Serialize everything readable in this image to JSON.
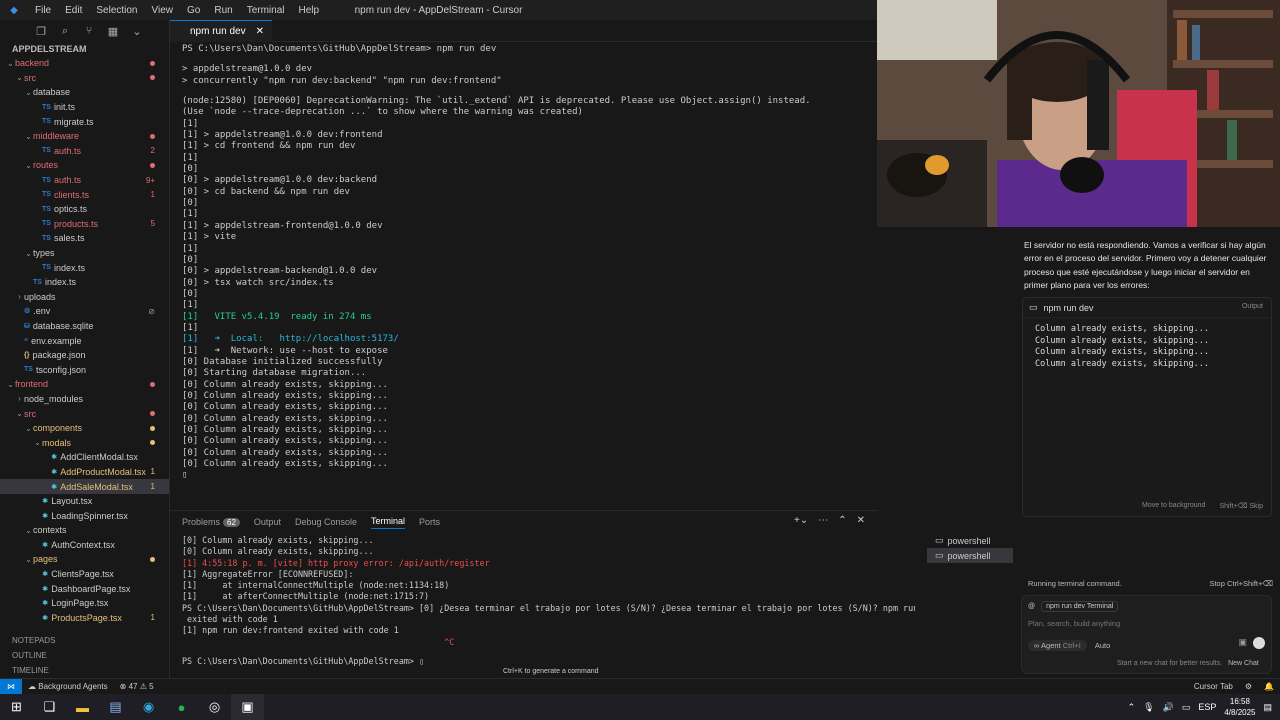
{
  "window": {
    "title": "npm run dev - AppDelStream - Cursor",
    "menu": [
      "File",
      "Edit",
      "Selection",
      "View",
      "Go",
      "Run",
      "Terminal",
      "Help"
    ]
  },
  "explorer": {
    "root": "APPDELSTREAM",
    "items": [
      {
        "label": "backend",
        "depth": 0,
        "kind": "folder-open",
        "color": "#e06c75",
        "dot": true
      },
      {
        "label": "src",
        "depth": 1,
        "kind": "folder-open",
        "color": "#e06c75",
        "dot": true
      },
      {
        "label": "database",
        "depth": 2,
        "kind": "folder-open",
        "color": "#cccccc"
      },
      {
        "label": "init.ts",
        "depth": 3,
        "kind": "ts",
        "color": "#cccccc"
      },
      {
        "label": "migrate.ts",
        "depth": 3,
        "kind": "ts",
        "color": "#cccccc"
      },
      {
        "label": "middleware",
        "depth": 2,
        "kind": "folder-open",
        "color": "#e06c75",
        "dot": true
      },
      {
        "label": "auth.ts",
        "depth": 3,
        "kind": "ts",
        "color": "#e06c75",
        "badge": "2"
      },
      {
        "label": "routes",
        "depth": 2,
        "kind": "folder-open",
        "color": "#e06c75",
        "dot": true
      },
      {
        "label": "auth.ts",
        "depth": 3,
        "kind": "ts",
        "color": "#e06c75",
        "badge": "9+"
      },
      {
        "label": "clients.ts",
        "depth": 3,
        "kind": "ts",
        "color": "#e06c75",
        "badge": "1"
      },
      {
        "label": "optics.ts",
        "depth": 3,
        "kind": "ts",
        "color": "#cccccc"
      },
      {
        "label": "products.ts",
        "depth": 3,
        "kind": "ts",
        "color": "#e06c75",
        "badge": "5"
      },
      {
        "label": "sales.ts",
        "depth": 3,
        "kind": "ts",
        "color": "#cccccc"
      },
      {
        "label": "types",
        "depth": 2,
        "kind": "folder-open",
        "color": "#cccccc"
      },
      {
        "label": "index.ts",
        "depth": 3,
        "kind": "ts",
        "color": "#cccccc"
      },
      {
        "label": "index.ts",
        "depth": 2,
        "kind": "ts",
        "color": "#cccccc"
      },
      {
        "label": "uploads",
        "depth": 1,
        "kind": "folder",
        "color": "#cccccc"
      },
      {
        "label": ".env",
        "depth": 1,
        "kind": "gear",
        "color": "#cccccc",
        "badge": "⊘"
      },
      {
        "label": "database.sqlite",
        "depth": 1,
        "kind": "db",
        "color": "#cccccc"
      },
      {
        "label": "env.example",
        "depth": 1,
        "kind": "file",
        "color": "#cccccc"
      },
      {
        "label": "package.json",
        "depth": 1,
        "kind": "json",
        "color": "#cccccc"
      },
      {
        "label": "tsconfig.json",
        "depth": 1,
        "kind": "tsjson",
        "color": "#cccccc"
      },
      {
        "label": "frontend",
        "depth": 0,
        "kind": "folder-open",
        "color": "#e06c75",
        "dot": true
      },
      {
        "label": "node_modules",
        "depth": 1,
        "kind": "folder",
        "color": "#cccccc"
      },
      {
        "label": "src",
        "depth": 1,
        "kind": "folder-open",
        "color": "#e06c75",
        "dot": true
      },
      {
        "label": "components",
        "depth": 2,
        "kind": "folder-open",
        "color": "#e5c07b",
        "dot": true
      },
      {
        "label": "modals",
        "depth": 3,
        "kind": "folder-open",
        "color": "#e5c07b",
        "dot": true
      },
      {
        "label": "AddClientModal.tsx",
        "depth": 4,
        "kind": "tsx",
        "color": "#cccccc"
      },
      {
        "label": "AddProductModal.tsx",
        "depth": 4,
        "kind": "tsx",
        "color": "#e5c07b",
        "badge": "1"
      },
      {
        "label": "AddSaleModal.tsx",
        "depth": 4,
        "kind": "tsx",
        "color": "#e5c07b",
        "badge": "1",
        "selected": true
      },
      {
        "label": "Layout.tsx",
        "depth": 3,
        "kind": "tsx",
        "color": "#cccccc"
      },
      {
        "label": "LoadingSpinner.tsx",
        "depth": 3,
        "kind": "tsx",
        "color": "#cccccc"
      },
      {
        "label": "contexts",
        "depth": 2,
        "kind": "folder-open",
        "color": "#cccccc"
      },
      {
        "label": "AuthContext.tsx",
        "depth": 3,
        "kind": "tsx",
        "color": "#cccccc"
      },
      {
        "label": "pages",
        "depth": 2,
        "kind": "folder-open",
        "color": "#e5c07b",
        "dot": true
      },
      {
        "label": "ClientsPage.tsx",
        "depth": 3,
        "kind": "tsx",
        "color": "#cccccc"
      },
      {
        "label": "DashboardPage.tsx",
        "depth": 3,
        "kind": "tsx",
        "color": "#cccccc"
      },
      {
        "label": "LoginPage.tsx",
        "depth": 3,
        "kind": "tsx",
        "color": "#cccccc"
      },
      {
        "label": "ProductsPage.tsx",
        "depth": 3,
        "kind": "tsx",
        "color": "#e5c07b",
        "badge": "1"
      }
    ],
    "footer": {
      "notepads": "NOTEPADS",
      "outline": "OUTLINE",
      "timeline": "TIMELINE"
    }
  },
  "editor": {
    "tab_label": "npm run dev",
    "lines": [
      {
        "t": "PS C:\\Users\\Dan\\Documents\\GitHub\\AppDelStream> npm run dev",
        "c": "#cccccc"
      },
      {
        "t": "",
        "c": "#cccccc"
      },
      {
        "t": "> appdelstream@1.0.0 dev",
        "c": "#cccccc"
      },
      {
        "t": "> concurrently \"npm run dev:backend\" \"npm run dev:frontend\"",
        "c": "#cccccc"
      },
      {
        "t": "",
        "c": "#cccccc"
      },
      {
        "t": "(node:12580) [DEP0060] DeprecationWarning: The `util._extend` API is deprecated. Please use Object.assign() instead.",
        "c": "#cccccc"
      },
      {
        "t": "(Use `node --trace-deprecation ...` to show where the warning was created)",
        "c": "#cccccc"
      },
      {
        "t": "[1]",
        "c": "#cccccc"
      },
      {
        "t": "[1] > appdelstream@1.0.0 dev:frontend",
        "c": "#cccccc"
      },
      {
        "t": "[1] > cd frontend && npm run dev",
        "c": "#cccccc"
      },
      {
        "t": "[1]",
        "c": "#cccccc"
      },
      {
        "t": "[0]",
        "c": "#cccccc"
      },
      {
        "t": "[0] > appdelstream@1.0.0 dev:backend",
        "c": "#cccccc"
      },
      {
        "t": "[0] > cd backend && npm run dev",
        "c": "#cccccc"
      },
      {
        "t": "[0]",
        "c": "#cccccc"
      },
      {
        "t": "[1]",
        "c": "#cccccc"
      },
      {
        "t": "[1] > appdelstream-frontend@1.0.0 dev",
        "c": "#cccccc"
      },
      {
        "t": "[1] > vite",
        "c": "#cccccc"
      },
      {
        "t": "[1]",
        "c": "#cccccc"
      },
      {
        "t": "[0]",
        "c": "#cccccc"
      },
      {
        "t": "[0] > appdelstream-backend@1.0.0 dev",
        "c": "#cccccc"
      },
      {
        "t": "[0] > tsx watch src/index.ts",
        "c": "#cccccc"
      },
      {
        "t": "[0]",
        "c": "#cccccc"
      },
      {
        "t": "[1]",
        "c": "#cccccc"
      },
      {
        "t": "[1]   VITE v5.4.19  ready in 274 ms",
        "c": "#23d18b"
      },
      {
        "t": "[1]",
        "c": "#cccccc"
      },
      {
        "t": "[1]   ➜  Local:   http://localhost:5173/",
        "c": "#29b8db"
      },
      {
        "t": "[1]   ➜  Network: use --host to expose",
        "c": "#cccccc"
      },
      {
        "t": "[0] Database initialized successfully",
        "c": "#cccccc"
      },
      {
        "t": "[0] Starting database migration...",
        "c": "#cccccc"
      },
      {
        "t": "[0] Column already exists, skipping...",
        "c": "#cccccc"
      },
      {
        "t": "[0] Column already exists, skipping...",
        "c": "#cccccc"
      },
      {
        "t": "[0] Column already exists, skipping...",
        "c": "#cccccc"
      },
      {
        "t": "[0] Column already exists, skipping...",
        "c": "#cccccc"
      },
      {
        "t": "[0] Column already exists, skipping...",
        "c": "#cccccc"
      },
      {
        "t": "[0] Column already exists, skipping...",
        "c": "#cccccc"
      },
      {
        "t": "[0] Column already exists, skipping...",
        "c": "#cccccc"
      },
      {
        "t": "[0] Column already exists, skipping...",
        "c": "#cccccc"
      },
      {
        "t": "▯",
        "c": "#cccccc"
      }
    ]
  },
  "panel": {
    "tabs": [
      "Problems",
      "Output",
      "Debug Console",
      "Terminal",
      "Ports"
    ],
    "problems_count": "62",
    "active_tab": "Terminal",
    "terminal_lines": [
      {
        "t": "[0] Column already exists, skipping...",
        "c": "#cccccc"
      },
      {
        "t": "[0] Column already exists, skipping...",
        "c": "#cccccc"
      },
      {
        "t": "[1] 4:55:18 p. m. [vite] http proxy error: /api/auth/register",
        "c": "#f14c4c"
      },
      {
        "t": "[1] AggregateError [ECONNREFUSED]:",
        "c": "#cccccc"
      },
      {
        "t": "[1]     at internalConnectMultiple (node:net:1134:18)",
        "c": "#cccccc"
      },
      {
        "t": "[1]     at afterConnectMultiple (node:net:1715:7)",
        "c": "#cccccc"
      },
      {
        "t": "PS C:\\Users\\Dan\\Documents\\GitHub\\AppDelStream> [0] ¿Desea terminar el trabajo por lotes (S/N)? ¿Desea terminar el trabajo por lotes (S/N)? npm run dev:backend",
        "c": "#cccccc"
      },
      {
        "t": " exited with code 1",
        "c": "#cccccc"
      },
      {
        "t": "[1] npm run dev:frontend exited with code 1",
        "c": "#cccccc"
      },
      {
        "t": "                                                    ^C",
        "c": "#f14c4c"
      },
      {
        "t": "",
        "c": "#cccccc"
      },
      {
        "t": "PS C:\\Users\\Dan\\Documents\\GitHub\\AppDelStream> ▯",
        "c": "#cccccc"
      }
    ],
    "terminals": [
      "powershell",
      "powershell"
    ],
    "hint": "Ctrl+K to generate a command"
  },
  "chat": {
    "message": "El servidor no está respondiendo. Vamos a verificar si hay algún error en el proceso del servidor. Primero voy a detener cualquier proceso que esté ejecutándose y luego iniciar el servidor en primer plano para ver los errores:",
    "command": "npm run dev",
    "output_label": "Output",
    "output": "Column already exists, skipping...\nColumn already exists, skipping...\nColumn already exists, skipping...\nColumn already exists, skipping...",
    "move_bg": "Move to background",
    "skip": "Shift+⌫ Skip",
    "running": "Running terminal command.",
    "stop": "Stop Ctrl+Shift+⌫",
    "context_pill": "npm run dev Terminal",
    "placeholder": "Plan, search, build anything",
    "agent": "Agent",
    "agent_shortcut": "Ctrl+I",
    "model": "Auto",
    "new_chat_hint": "Start a new chat for better results.",
    "new_chat": "New Chat"
  },
  "statusbar": {
    "background_agents": "Background Agents",
    "errors": "47",
    "warnings": "5",
    "cursor_tab": "Cursor Tab"
  },
  "taskbar": {
    "lang": "ESP",
    "time": "16:58",
    "date": "4/8/2025"
  }
}
